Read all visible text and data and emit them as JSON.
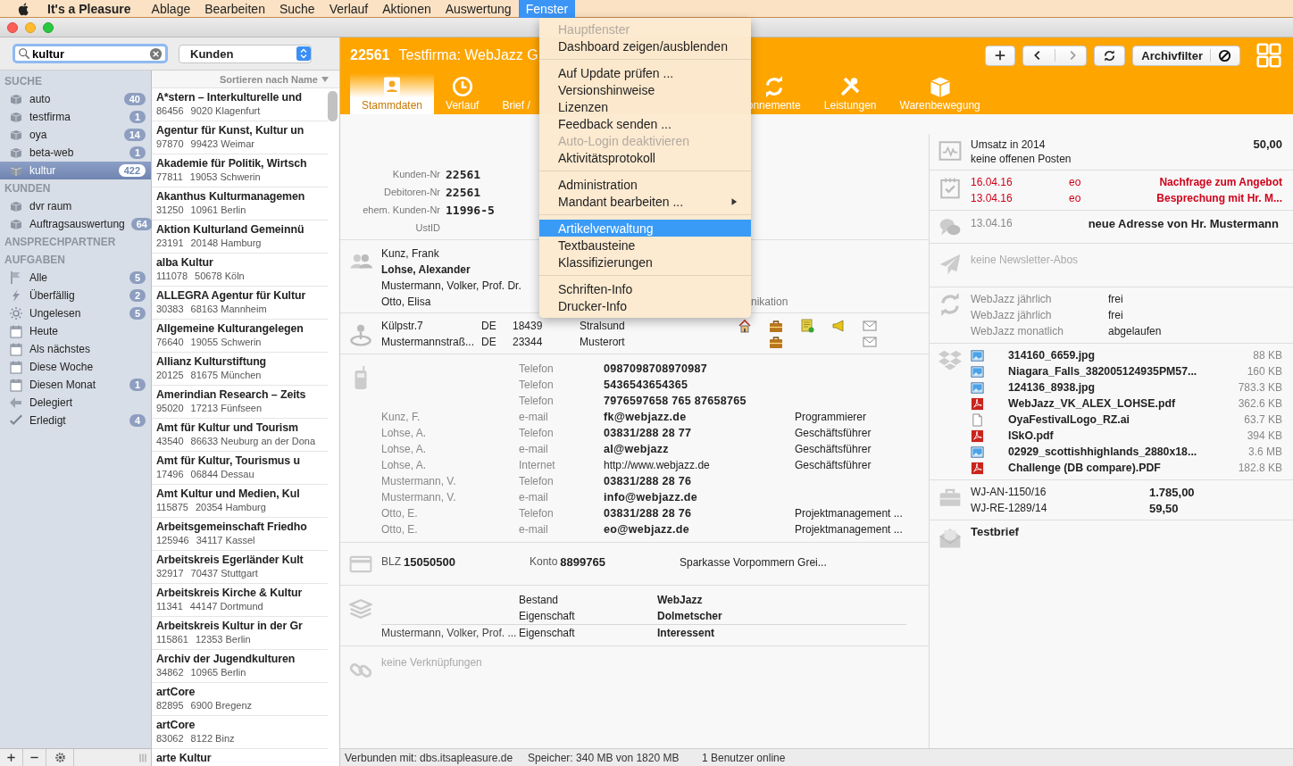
{
  "menubar": {
    "app": "It's a Pleasure",
    "menus": [
      {
        "label": "Ablage",
        "selected": false
      },
      {
        "label": "Bearbeiten",
        "selected": false
      },
      {
        "label": "Suche",
        "selected": false
      },
      {
        "label": "Verlauf",
        "selected": false
      },
      {
        "label": "Aktionen",
        "selected": false
      },
      {
        "label": "Auswertung",
        "selected": false
      },
      {
        "label": "Fenster",
        "selected": true
      }
    ]
  },
  "window_menu": {
    "items": [
      {
        "kind": "item",
        "label": "Hauptfenster",
        "disabled": true,
        "selected": false,
        "submenu": false
      },
      {
        "kind": "item",
        "label": "Dashboard zeigen/ausblenden",
        "disabled": false,
        "selected": false,
        "submenu": false
      },
      {
        "kind": "separator"
      },
      {
        "kind": "item",
        "label": "Auf Update prüfen ...",
        "disabled": false,
        "selected": false,
        "submenu": false
      },
      {
        "kind": "item",
        "label": "Versionshinweise",
        "disabled": false,
        "selected": false,
        "submenu": false
      },
      {
        "kind": "item",
        "label": "Lizenzen",
        "disabled": false,
        "selected": false,
        "submenu": false
      },
      {
        "kind": "item",
        "label": "Feedback senden ...",
        "disabled": false,
        "selected": false,
        "submenu": false
      },
      {
        "kind": "item",
        "label": "Auto-Login deaktivieren",
        "disabled": true,
        "selected": false,
        "submenu": false
      },
      {
        "kind": "item",
        "label": "Aktivitätsprotokoll",
        "disabled": false,
        "selected": false,
        "submenu": false
      },
      {
        "kind": "separator"
      },
      {
        "kind": "item",
        "label": "Administration",
        "disabled": false,
        "selected": false,
        "submenu": false
      },
      {
        "kind": "item",
        "label": "Mandant bearbeiten ...",
        "disabled": false,
        "selected": false,
        "submenu": true
      },
      {
        "kind": "separator"
      },
      {
        "kind": "item",
        "label": "Artikelverwaltung",
        "disabled": false,
        "selected": true,
        "submenu": false
      },
      {
        "kind": "item",
        "label": "Textbausteine",
        "disabled": false,
        "selected": false,
        "submenu": false
      },
      {
        "kind": "item",
        "label": "Klassifizierungen",
        "disabled": false,
        "selected": false,
        "submenu": false
      },
      {
        "kind": "separator"
      },
      {
        "kind": "item",
        "label": "Schriften-Info",
        "disabled": false,
        "selected": false,
        "submenu": false
      },
      {
        "kind": "item",
        "label": "Drucker-Info",
        "disabled": false,
        "selected": false,
        "submenu": false
      }
    ]
  },
  "search": {
    "value": "kultur"
  },
  "scope_select": {
    "value": "Kunden"
  },
  "sidebar": {
    "groups": [
      {
        "title": "SUCHE",
        "items": [
          {
            "label": "auto",
            "count": "40",
            "selected": false
          },
          {
            "label": "testfirma",
            "count": "1",
            "selected": false
          },
          {
            "label": "oya",
            "count": "14",
            "selected": false
          },
          {
            "label": "beta-web",
            "count": "1",
            "selected": false
          },
          {
            "label": "kultur",
            "count": "422",
            "selected": true
          }
        ]
      },
      {
        "title": "KUNDEN",
        "items": [
          {
            "label": "dvr raum",
            "selected": false
          },
          {
            "label": "Auftragsauswertung",
            "count": "64",
            "selected": false
          }
        ]
      },
      {
        "title": "ANSPRECHPARTNER"
      },
      {
        "title": "AUFGABEN",
        "items": [
          {
            "label": "Alle",
            "count": "5",
            "selected": false
          },
          {
            "label": "Überfällig",
            "count": "2",
            "selected": false
          },
          {
            "label": "Ungelesen",
            "count": "5",
            "selected": false
          },
          {
            "label": "Heute",
            "selected": false
          },
          {
            "label": "Als nächstes",
            "selected": false
          },
          {
            "label": "Diese Woche",
            "selected": false
          },
          {
            "label": "Diesen Monat",
            "count": "1",
            "selected": false
          },
          {
            "label": "Delegiert",
            "selected": false
          },
          {
            "label": "Erledigt",
            "count": "4",
            "selected": false
          }
        ]
      }
    ]
  },
  "list": {
    "sort_label": "Sortieren nach Name",
    "rows": [
      {
        "name": "A*stern – Interkulturelle und",
        "number": "86456",
        "place": "9020 Klagenfurt"
      },
      {
        "name": "Agentur für Kunst, Kultur un",
        "number": "97870",
        "place": "99423 Weimar"
      },
      {
        "name": "Akademie für Politik, Wirtsch",
        "number": "77811",
        "place": "19053 Schwerin"
      },
      {
        "name": "Akanthus Kulturmanagemen",
        "number": "31250",
        "place": "10961 Berlin"
      },
      {
        "name": "Aktion Kulturland Gemeinnü",
        "number": "23191",
        "place": "20148 Hamburg"
      },
      {
        "name": "alba Kultur",
        "number": "111078",
        "place": "50678 Köln"
      },
      {
        "name": "ALLEGRA Agentur für Kultur",
        "number": "30383",
        "place": "68163 Mannheim"
      },
      {
        "name": "Allgemeine Kulturangelegen",
        "number": "76640",
        "place": "19055 Schwerin"
      },
      {
        "name": "Allianz Kulturstiftung",
        "number": "20125",
        "place": "81675 München"
      },
      {
        "name": "Amerindian Research – Zeits",
        "number": "95020",
        "place": "17213 Fünfseen"
      },
      {
        "name": "Amt für Kultur und Tourism",
        "number": "43540",
        "place": "86633 Neuburg an der Dona"
      },
      {
        "name": "Amt für Kultur, Tourismus u",
        "number": "17496",
        "place": "06844 Dessau"
      },
      {
        "name": "Amt Kultur und Medien,  Kul",
        "number": "115875",
        "place": "20354 Hamburg"
      },
      {
        "name": "Arbeitsgemeinschaft Friedho",
        "number": "125946",
        "place": "34117 Kassel"
      },
      {
        "name": "Arbeitskreis Egerländer Kult",
        "number": "32917",
        "place": "70437 Stuttgart"
      },
      {
        "name": "Arbeitskreis Kirche & Kultur",
        "number": "11341",
        "place": "44147 Dortmund"
      },
      {
        "name": "Arbeitskreis Kultur in der Gr",
        "number": "115861",
        "place": "12353 Berlin"
      },
      {
        "name": "Archiv der Jugendkulturen",
        "number": "34862",
        "place": "10965 Berlin"
      },
      {
        "name": "artCore",
        "number": "82895",
        "place": "6900 Bregenz"
      },
      {
        "name": "artCore",
        "number": "83062",
        "place": "8122 Binz"
      },
      {
        "name": "arte Kultur"
      }
    ]
  },
  "record": {
    "number": "22561",
    "title": "Testfirma: WebJazz G",
    "filter_label": "Archivfilter",
    "tabs": [
      {
        "label": "Stammdaten",
        "selected": true
      },
      {
        "label": "Verlauf",
        "selected": false
      },
      {
        "label": "Brief /",
        "selected": false
      },
      {
        "label": "onnemente",
        "selected": false
      },
      {
        "label": "Leistungen",
        "selected": false
      },
      {
        "label": "Warenbewegung",
        "selected": false
      }
    ]
  },
  "ids": [
    {
      "label": "Kunden-Nr",
      "value": "22561"
    },
    {
      "label": "Debitoren-Nr",
      "value": "22561"
    },
    {
      "label": "ehem. Kunden-Nr",
      "value": "11996-5"
    },
    {
      "label": "UstID"
    }
  ],
  "contacts": {
    "column_label": "nikation",
    "people": [
      {
        "name": "Kunz, Frank",
        "primary": false
      },
      {
        "name": "Lohse, Alexander",
        "primary": true
      },
      {
        "name": "Mustermann, Volker, Prof. Dr.",
        "primary": false
      },
      {
        "name": "Otto, Elisa",
        "primary": false
      }
    ]
  },
  "addresses": [
    {
      "street": "Külpstr.7",
      "country": "DE",
      "zip": "18439",
      "city": "Stralsund",
      "home": true,
      "business": true,
      "note": true,
      "megaphone": true,
      "mail": true
    },
    {
      "street": "Mustermannstraß...",
      "country": "DE",
      "zip": "23344",
      "city": "Musterort",
      "home": false,
      "business": true,
      "note": false,
      "megaphone": false,
      "mail": true
    }
  ],
  "communication": [
    {
      "kind": "phone",
      "type": "Telefon",
      "value": "0987098708970987"
    },
    {
      "kind": "phone",
      "type": "Telefon",
      "value": "5436543654365"
    },
    {
      "kind": "phone",
      "type": "Telefon",
      "value": "7976597658 765 87658765"
    },
    {
      "kind": "email",
      "person": "Kunz, F.",
      "type": "e-mail",
      "value": "fk@webjazz.de",
      "role": "Programmierer"
    },
    {
      "kind": "phone",
      "person": "Lohse, A.",
      "type": "Telefon",
      "value": "03831/288 28 77",
      "role": "Geschäftsführer"
    },
    {
      "kind": "email",
      "person": "Lohse, A.",
      "type": "e-mail",
      "value": "al@webjazz",
      "role": "Geschäftsführer"
    },
    {
      "kind": "web",
      "person": "Lohse, A.",
      "type": "Internet",
      "value": "http://www.webjazz.de",
      "role": "Geschäftsführer"
    },
    {
      "kind": "phone",
      "person": "Mustermann, V.",
      "type": "Telefon",
      "value": "03831/288 28 76"
    },
    {
      "kind": "email",
      "person": "Mustermann, V.",
      "type": "e-mail",
      "value": "info@webjazz.de"
    },
    {
      "kind": "phone",
      "person": "Otto, E.",
      "type": "Telefon",
      "value": "03831/288 28 76",
      "role": "Projektmanagement ..."
    },
    {
      "kind": "email",
      "person": "Otto, E.",
      "type": "e-mail",
      "value": "eo@webjazz.de",
      "role": "Projektmanagement ..."
    }
  ],
  "bank": {
    "blz_label": "BLZ",
    "blz": "15050500",
    "account_label": "Konto",
    "account": "8899765",
    "bank_name": "Sparkasse Vorpommern Grei..."
  },
  "classifications": [
    {
      "type": "Bestand",
      "value": "WebJazz"
    },
    {
      "type": "Eigenschaft",
      "value": "Dolmetscher"
    },
    {
      "person": "Mustermann, Volker, Prof. ...",
      "type": "Eigenschaft",
      "value": "Interessent"
    }
  ],
  "links": {
    "empty_text": "keine Verknüpfungen"
  },
  "revenue": {
    "label": "Umsatz in 2014",
    "sub": "keine offenen Posten",
    "amount": "50,00"
  },
  "tasks": [
    {
      "date": "16.04.16",
      "user": "eo",
      "title": "Nachfrage zum Angebot",
      "overdue": true
    },
    {
      "date": "13.04.16",
      "user": "eo",
      "title": "Besprechung mit Hr. M...",
      "overdue": true
    }
  ],
  "notes": [
    {
      "date": "13.04.16",
      "text": "neue Adresse von Hr. Mustermann"
    }
  ],
  "newsletter": {
    "empty_text": "keine Newsletter-Abos"
  },
  "subscriptions": [
    {
      "name": "WebJazz jährlich",
      "status": "frei"
    },
    {
      "name": "WebJazz jährlich",
      "status": "frei"
    },
    {
      "name": "WebJazz monatlich",
      "status": "abgelaufen"
    }
  ],
  "files": [
    {
      "kind": "image",
      "name": "314160_6659.jpg",
      "size": "88 KB"
    },
    {
      "kind": "image",
      "name": "Niagara_Falls_382005124935PM57...",
      "size": "160 KB"
    },
    {
      "kind": "image",
      "name": "124136_8938.jpg",
      "size": "783.3 KB"
    },
    {
      "kind": "pdf",
      "name": "WebJazz_VK_ALEX_LOHSE.pdf",
      "size": "362.6 KB"
    },
    {
      "kind": "file",
      "name": "OyaFestivalLogo_RZ.ai",
      "size": "63.7 KB"
    },
    {
      "kind": "pdf",
      "name": "ISkO.pdf",
      "size": "394 KB"
    },
    {
      "kind": "image",
      "name": "02929_scottishhighlands_2880x18...",
      "size": "3.6 MB"
    },
    {
      "kind": "pdf",
      "name": "Challenge (DB compare).PDF",
      "size": "182.8 KB"
    }
  ],
  "documents": [
    {
      "number": "WJ-AN-1150/16",
      "amount": "1.785,00"
    },
    {
      "number": "WJ-RE-1289/14",
      "amount": "59,50"
    }
  ],
  "letters": [
    {
      "title": "Testbrief"
    }
  ],
  "status_bar": {
    "connection": "Verbunden mit: dbs.itsapleasure.de",
    "memory": "Speicher: 340 MB von 1820 MB",
    "users": "1 Benutzer online"
  }
}
